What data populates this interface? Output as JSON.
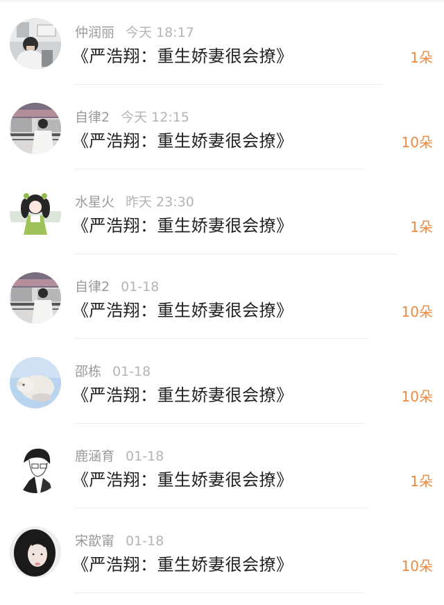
{
  "gift_list": {
    "items": [
      {
        "user_name": "仲润丽",
        "time": "今天 18:17",
        "book_title": "《严浩翔：重生娇妻很会撩》",
        "amount": "1朵"
      },
      {
        "user_name": "自律2",
        "time": "今天 12:15",
        "book_title": "《严浩翔：重生娇妻很会撩》",
        "amount": "10朵"
      },
      {
        "user_name": "水星火",
        "time": "昨天 23:30",
        "book_title": "《严浩翔：重生娇妻很会撩》",
        "amount": "1朵"
      },
      {
        "user_name": "自律2",
        "time": "01-18",
        "book_title": "《严浩翔：重生娇妻很会撩》",
        "amount": "10朵"
      },
      {
        "user_name": "邵栋",
        "time": "01-18",
        "book_title": "《严浩翔：重生娇妻很会撩》",
        "amount": "10朵"
      },
      {
        "user_name": "鹿涵育",
        "time": "01-18",
        "book_title": "《严浩翔：重生娇妻很会撩》",
        "amount": "1朵"
      },
      {
        "user_name": "宋歆甯",
        "time": "01-18",
        "book_title": "《严浩翔：重生娇妻很会撩》",
        "amount": "10朵"
      }
    ]
  },
  "colors": {
    "amount": "#ec8a3f",
    "title_text": "#222222",
    "meta_text": "#9a9a9a",
    "divider": "#ededed"
  }
}
